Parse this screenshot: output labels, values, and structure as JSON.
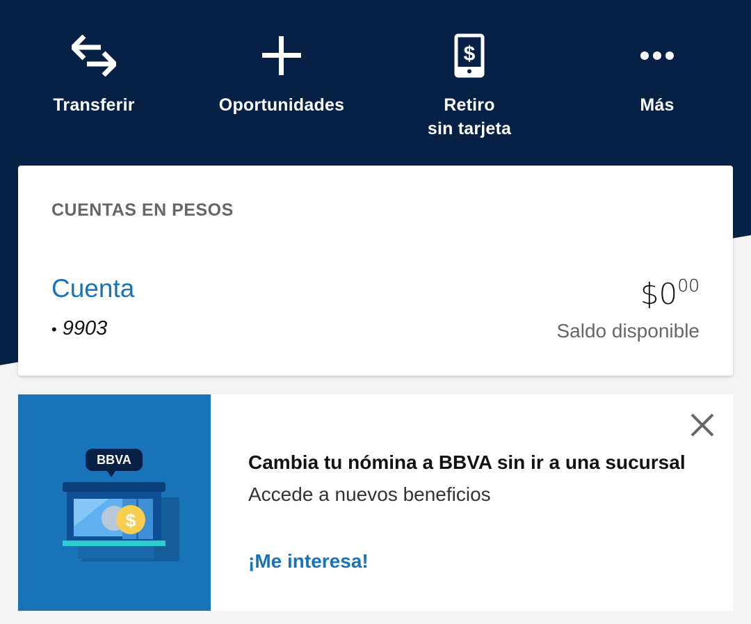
{
  "colors": {
    "navy": "#072146",
    "brand_blue": "#1973b8",
    "page_bg": "#f4f4f4"
  },
  "actions": [
    {
      "label": "Transferir",
      "icon": "transfer-arrows-icon"
    },
    {
      "label": "Oportunidades",
      "icon": "plus-icon"
    },
    {
      "label": "Retiro\nsin tarjeta",
      "icon": "phone-dollar-icon"
    },
    {
      "label": "Más",
      "icon": "more-dots-icon"
    }
  ],
  "accounts": {
    "section_title": "CUENTAS EN PESOS",
    "account_name": "Cuenta",
    "account_bullet": "•",
    "account_number": "9903",
    "balance_main": "$0",
    "balance_cents": "00",
    "balance_label": "Saldo disponible"
  },
  "promo": {
    "logo_text": "BBVA",
    "title": "Cambia tu nómina a BBVA sin ir a una sucursal",
    "subtitle": "Accede a nuevos beneficios",
    "cta": "¡Me interesa!",
    "close_icon": "close-icon"
  }
}
